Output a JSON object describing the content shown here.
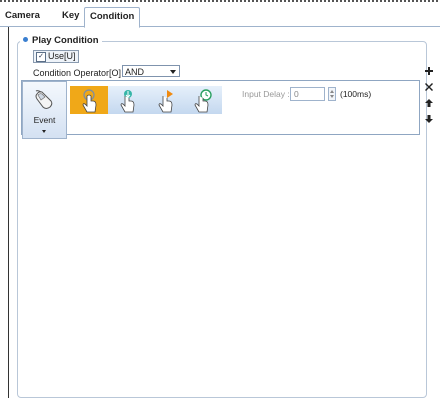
{
  "tabs": [
    {
      "label": "Camera",
      "active": false
    },
    {
      "label": "Key",
      "active": false
    },
    {
      "label": "Condition",
      "active": true
    }
  ],
  "section": {
    "title": "Play Condition"
  },
  "use_checkbox": {
    "label": "Use[U]",
    "checked": true
  },
  "condition_operator": {
    "label": "Condition Operator[O] :",
    "selected": "AND"
  },
  "event_button": {
    "label": "Event"
  },
  "icon_strip": [
    {
      "name": "mouse-press",
      "selected": true
    },
    {
      "name": "mouse-drag",
      "selected": false
    },
    {
      "name": "mouse-play",
      "selected": false
    },
    {
      "name": "mouse-timer",
      "selected": false
    }
  ],
  "input_delay": {
    "label": "Input Delay :",
    "value": "0",
    "unit": "(100ms)"
  },
  "side_actions": [
    "add-icon",
    "delete-icon",
    "move-up-icon",
    "move-down-icon"
  ],
  "colors": {
    "selected_icon_bg": "#f0a818",
    "accent_blue": "#3a7fd0",
    "border": "#9fb3cc"
  }
}
